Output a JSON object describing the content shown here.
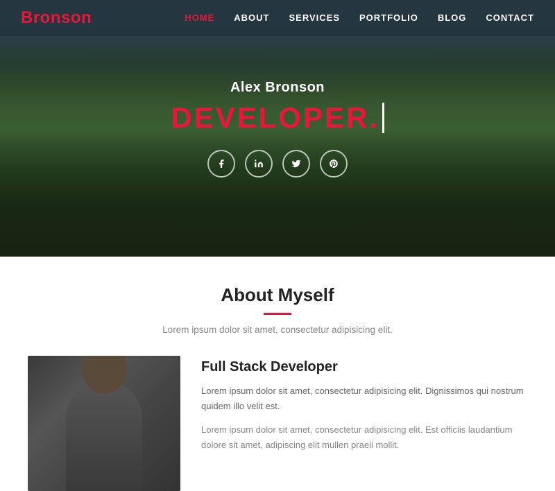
{
  "brand": {
    "letter_red": "B",
    "letter_rest": "ronson"
  },
  "nav": {
    "links": [
      {
        "label": "HOME",
        "active": true
      },
      {
        "label": "ABOUT",
        "active": false
      },
      {
        "label": "SERVICES",
        "active": false
      },
      {
        "label": "PORTFOLIO",
        "active": false
      },
      {
        "label": "BLOG",
        "active": false
      },
      {
        "label": "CONTACT",
        "active": false
      }
    ]
  },
  "hero": {
    "name": "Alex Bronson",
    "title": "DEVELOPER.",
    "social": [
      {
        "icon": "f",
        "name": "facebook-icon"
      },
      {
        "icon": "in",
        "name": "linkedin-icon"
      },
      {
        "icon": "t",
        "name": "twitter-icon"
      },
      {
        "icon": "p",
        "name": "pinterest-icon"
      }
    ]
  },
  "about": {
    "section_title": "About Myself",
    "subtitle": "Lorem ipsum dolor sit amet, consectetur adipisicing elit.",
    "job_title": "Full Stack Developer",
    "para1": "Lorem ipsum dolor sit amet, consectetur adipisicing elit. Dignissimos qui nostrum quidem illo velit est.",
    "para2": "Lorem ipsum dolor sit amet, consectetur adipisicing elit. Est officiis laudantium dolore sit amet, adipiscing elit mullen praeli mollit."
  }
}
